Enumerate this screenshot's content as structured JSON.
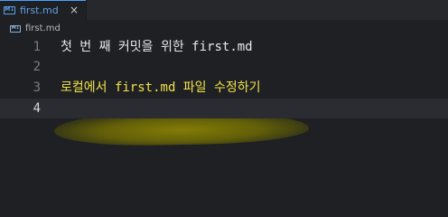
{
  "tab": {
    "icon": "markdown-icon",
    "icon_glyph": "M↓",
    "label": "first.md",
    "close": "×",
    "accent_color": "#4aa0ff"
  },
  "breadcrumb": {
    "icon": "markdown-icon",
    "icon_glyph": "M↓",
    "label": "first.md"
  },
  "editor": {
    "current_line": 4,
    "highlight_color": "#8c8700",
    "lines": [
      {
        "number": "1",
        "text": "첫 번 째 커밋을 위한 first.md",
        "color": "#e8e8e8"
      },
      {
        "number": "2",
        "text": "",
        "color": "#e8e8e8"
      },
      {
        "number": "3",
        "text": "로컬에서 first.md 파일 수정하기",
        "color": "#f2e24a"
      },
      {
        "number": "4",
        "text": "",
        "color": "#e8e8e8"
      }
    ]
  }
}
